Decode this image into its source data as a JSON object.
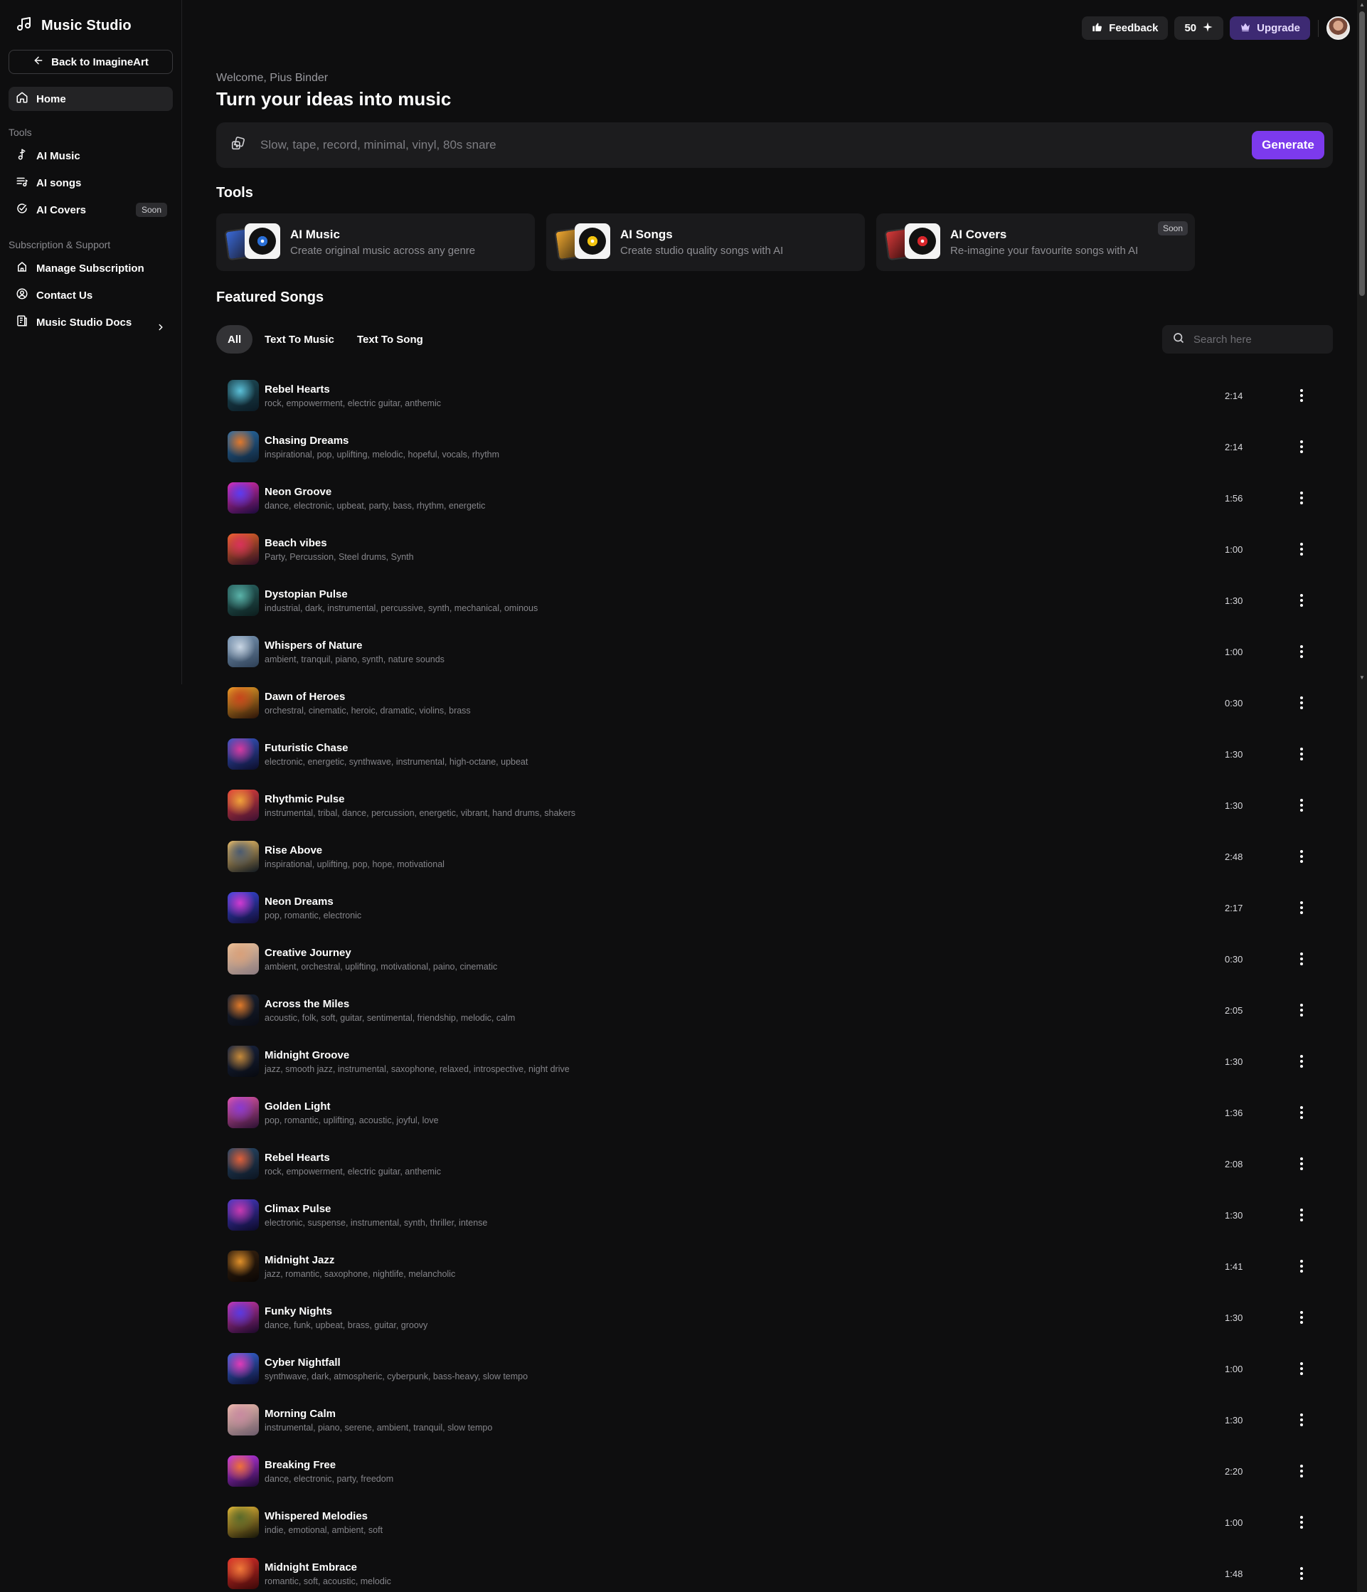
{
  "app": {
    "title": "Music Studio",
    "back_label": "Back to ImagineArt"
  },
  "sidebar": {
    "home_label": "Home",
    "tools_heading": "Tools",
    "tools": [
      {
        "label": "AI Music",
        "icon": "music-note-icon"
      },
      {
        "label": "AI songs",
        "icon": "playlist-icon"
      },
      {
        "label": "AI Covers",
        "icon": "cover-disc-icon",
        "badge": "Soon"
      }
    ],
    "support_heading": "Subscription & Support",
    "support": [
      {
        "label": "Manage Subscription",
        "icon": "subscription-icon"
      },
      {
        "label": "Contact Us",
        "icon": "contact-icon"
      },
      {
        "label": "Music Studio Docs",
        "icon": "docs-icon"
      }
    ]
  },
  "topbar": {
    "feedback_label": "Feedback",
    "credits_label": "50",
    "upgrade_label": "Upgrade"
  },
  "main": {
    "welcome": "Welcome, Pius Binder",
    "headline": "Turn your ideas into music",
    "prompt_placeholder": "Slow, tape, record, minimal, vinyl, 80s snare",
    "generate_label": "Generate",
    "tools_title": "Tools",
    "tool_cards": [
      {
        "name": "AI Music",
        "desc": "Create original music across any genre",
        "disc_color": "#2a6fd6"
      },
      {
        "name": "AI Songs",
        "desc": "Create studio quality songs with AI",
        "disc_color": "#f2c40f"
      },
      {
        "name": "AI Covers",
        "desc": "Re-imagine your favourite songs with AI",
        "disc_color": "#d8262b",
        "badge": "Soon"
      }
    ],
    "featured_title": "Featured Songs",
    "filters": [
      "All",
      "Text To Music",
      "Text To Song"
    ],
    "search_placeholder": "Search here"
  },
  "songs": [
    {
      "title": "Rebel Hearts",
      "tags": "rock, empowerment, electric guitar, anthemic",
      "duration": "2:14",
      "colors": [
        "#1f4e5a",
        "#5bc0d8",
        "#0b1a24"
      ]
    },
    {
      "title": "Chasing Dreams",
      "tags": "inspirational, pop, uplifting, melodic, hopeful, vocals, rhythm",
      "duration": "2:14",
      "colors": [
        "#2a6ea8",
        "#e0782c",
        "#0e2134"
      ]
    },
    {
      "title": "Neon Groove",
      "tags": "dance, electronic, upbeat, party, bass, rhythm, energetic",
      "duration": "1:56",
      "colors": [
        "#e22fb2",
        "#5b3cf0",
        "#1a0a3a"
      ]
    },
    {
      "title": "Beach vibes",
      "tags": "Party, Percussion, Steel drums, Synth",
      "duration": "1:00",
      "colors": [
        "#f06a2a",
        "#d8325a",
        "#2a0c22"
      ]
    },
    {
      "title": "Dystopian Pulse",
      "tags": "industrial, dark, instrumental, percussive, synth, mechanical, ominous",
      "duration": "1:30",
      "colors": [
        "#2c6a68",
        "#5ab3a9",
        "#0c1c1c"
      ]
    },
    {
      "title": "Whispers of Nature",
      "tags": "ambient, tranquil, piano, synth, nature sounds",
      "duration": "1:00",
      "colors": [
        "#7d9ab8",
        "#c9d6e4",
        "#2d3f55"
      ]
    },
    {
      "title": "Dawn of Heroes",
      "tags": "orchestral, cinematic, heroic, dramatic, violins, brass",
      "duration": "0:30",
      "colors": [
        "#f3a52a",
        "#c8461c",
        "#2a1308"
      ]
    },
    {
      "title": "Futuristic Chase",
      "tags": "electronic, energetic, synthwave, instrumental, high-octane, upbeat",
      "duration": "1:30",
      "colors": [
        "#3a58c8",
        "#d63aa0",
        "#0b0d2a"
      ]
    },
    {
      "title": "Rhythmic Pulse",
      "tags": "instrumental, tribal, dance, percussion, energetic, vibrant, hand drums, shakers",
      "duration": "1:30",
      "colors": [
        "#e8433a",
        "#f0a23a",
        "#3a0f32"
      ]
    },
    {
      "title": "Rise Above",
      "tags": "inspirational, uplifting, pop, hope, motivational",
      "duration": "2:48",
      "colors": [
        "#f6c56a",
        "#4a5a70",
        "#101820"
      ]
    },
    {
      "title": "Neon Dreams",
      "tags": "pop, romantic, electronic",
      "duration": "2:17",
      "colors": [
        "#3a4ae0",
        "#d03ad0",
        "#100c30"
      ]
    },
    {
      "title": "Creative Journey",
      "tags": "ambient, orchestral, uplifting, motivational, paino, cinematic",
      "duration": "0:30",
      "colors": [
        "#f2c59a",
        "#d8a07a",
        "#8a7a80"
      ]
    },
    {
      "title": "Across the Miles",
      "tags": "acoustic, folk, soft, guitar, sentimental, friendship, melodic, calm",
      "duration": "2:05",
      "colors": [
        "#1a2436",
        "#e07a2a",
        "#0a0c14"
      ]
    },
    {
      "title": "Midnight Groove",
      "tags": "jazz, smooth jazz, instrumental, saxophone, relaxed, introspective, night drive",
      "duration": "1:30",
      "colors": [
        "#1b2744",
        "#c68a3a",
        "#07090f"
      ]
    },
    {
      "title": "Golden Light",
      "tags": "pop, romantic, uplifting, acoustic, joyful, love",
      "duration": "1:36",
      "colors": [
        "#e85ab0",
        "#8a3ad0",
        "#2a1030"
      ]
    },
    {
      "title": "Rebel Hearts",
      "tags": "rock, empowerment, electric guitar, anthemic",
      "duration": "2:08",
      "colors": [
        "#2a4a6a",
        "#e0603a",
        "#0b1420"
      ]
    },
    {
      "title": "Climax Pulse",
      "tags": "electronic, suspense, instrumental, synth, thriller, intense",
      "duration": "1:30",
      "colors": [
        "#4a3ac8",
        "#c83ab0",
        "#0a0a28"
      ]
    },
    {
      "title": "Midnight Jazz",
      "tags": "jazz, romantic, saxophone, nightlife, melancholic",
      "duration": "1:41",
      "colors": [
        "#3a2410",
        "#e0902a",
        "#0a0604"
      ]
    },
    {
      "title": "Funky Nights",
      "tags": "dance, funk, upbeat, brass, guitar, groovy",
      "duration": "1:30",
      "colors": [
        "#d03ab0",
        "#5a3ae0",
        "#1a0828"
      ]
    },
    {
      "title": "Cyber Nightfall",
      "tags": "synthwave, dark, atmospheric, cyberpunk, bass-heavy, slow tempo",
      "duration": "1:00",
      "colors": [
        "#3a6ae0",
        "#e03ab8",
        "#0a0c2a"
      ]
    },
    {
      "title": "Morning Calm",
      "tags": "instrumental, piano, serene, ambient, tranquil, slow tempo",
      "duration": "1:30",
      "colors": [
        "#f5c0b0",
        "#c88aa0",
        "#6a5a6a"
      ]
    },
    {
      "title": "Breaking Free",
      "tags": "dance, electronic, party, freedom",
      "duration": "2:20",
      "colors": [
        "#c83af0",
        "#f0703a",
        "#1a0830"
      ]
    },
    {
      "title": "Whispered Melodies",
      "tags": "indie, emotional, ambient, soft",
      "duration": "1:00",
      "colors": [
        "#f0c03a",
        "#5a6a2a",
        "#141408"
      ]
    },
    {
      "title": "Midnight Embrace",
      "tags": "romantic, soft, acoustic, melodic",
      "duration": "1:48",
      "colors": [
        "#e0302a",
        "#f07a3a",
        "#3a0808"
      ]
    }
  ]
}
